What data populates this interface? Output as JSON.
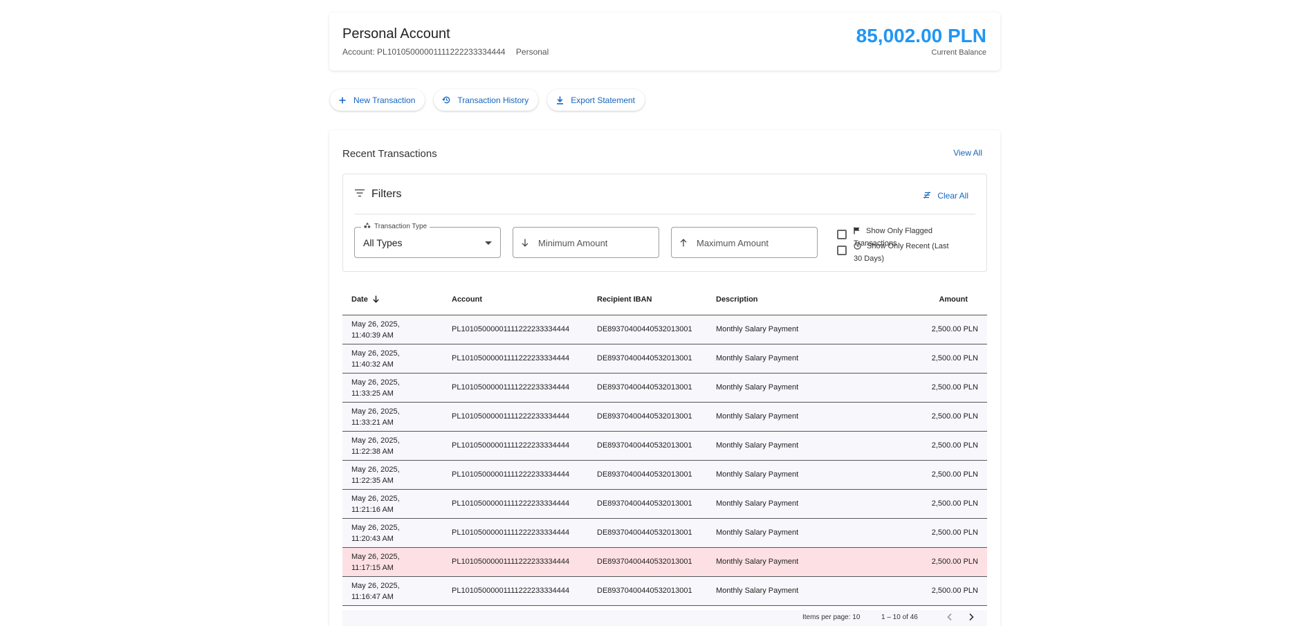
{
  "account": {
    "title": "Personal Account",
    "account_number": "Account: PL10105000001111222233334444",
    "account_type": "Personal",
    "balance": "85,002.00 PLN",
    "balance_label": "Current Balance",
    "balance_color": "#2196f3"
  },
  "actions": {
    "new_transaction": "New Transaction",
    "transaction_history": "Transaction History",
    "export_statement": "Export Statement"
  },
  "transactions": {
    "title": "Recent Transactions",
    "view_all": "View All"
  },
  "filters": {
    "title": "Filters",
    "clear_all": "Clear All",
    "type_label": "Transaction Type",
    "type_value": "All Types",
    "min_placeholder": "Minimum Amount",
    "max_placeholder": "Maximum Amount",
    "flagged_label": "Show Only Flagged Transactions",
    "recent_label": "Show Only Recent (Last 30 Days)"
  },
  "table": {
    "headers": {
      "date": "Date",
      "account": "Account",
      "iban": "Recipient IBAN",
      "description": "Description",
      "amount": "Amount"
    },
    "rows": [
      {
        "date": "May 26, 2025, 11:40:39 AM",
        "account": "PL10105000001111222233334444",
        "iban": "DE89370400440532013001",
        "description": "Monthly Salary Payment",
        "amount": "2,500.00 PLN"
      },
      {
        "date": "May 26, 2025, 11:40:32 AM",
        "account": "PL10105000001111222233334444",
        "iban": "DE89370400440532013001",
        "description": "Monthly Salary Payment",
        "amount": "2,500.00 PLN"
      },
      {
        "date": "May 26, 2025, 11:33:25 AM",
        "account": "PL10105000001111222233334444",
        "iban": "DE89370400440532013001",
        "description": "Monthly Salary Payment",
        "amount": "2,500.00 PLN"
      },
      {
        "date": "May 26, 2025, 11:33:21 AM",
        "account": "PL10105000001111222233334444",
        "iban": "DE89370400440532013001",
        "description": "Monthly Salary Payment",
        "amount": "2,500.00 PLN"
      },
      {
        "date": "May 26, 2025, 11:22:38 AM",
        "account": "PL10105000001111222233334444",
        "iban": "DE89370400440532013001",
        "description": "Monthly Salary Payment",
        "amount": "2,500.00 PLN"
      },
      {
        "date": "May 26, 2025, 11:22:35 AM",
        "account": "PL10105000001111222233334444",
        "iban": "DE89370400440532013001",
        "description": "Monthly Salary Payment",
        "amount": "2,500.00 PLN"
      },
      {
        "date": "May 26, 2025, 11:21:16 AM",
        "account": "PL10105000001111222233334444",
        "iban": "DE89370400440532013001",
        "description": "Monthly Salary Payment",
        "amount": "2,500.00 PLN"
      },
      {
        "date": "May 26, 2025, 11:20:43 AM",
        "account": "PL10105000001111222233334444",
        "iban": "DE89370400440532013001",
        "description": "Monthly Salary Payment",
        "amount": "2,500.00 PLN"
      },
      {
        "date": "May 26, 2025, 11:17:15 AM",
        "account": "PL10105000001111222233334444",
        "iban": "DE89370400440532013001",
        "description": "Monthly Salary Payment",
        "amount": "2,500.00 PLN",
        "flagged": true
      },
      {
        "date": "May 26, 2025, 11:16:47 AM",
        "account": "PL10105000001111222233334444",
        "iban": "DE89370400440532013001",
        "description": "Monthly Salary Payment",
        "amount": "2,500.00 PLN"
      }
    ],
    "flagged_row_color": "#fde0e4"
  },
  "paginator": {
    "items_per_page": "Items per page: 10",
    "range": "1 – 10 of 46"
  }
}
